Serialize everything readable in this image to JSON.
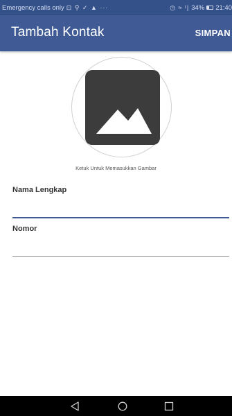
{
  "status_bar": {
    "carrier_text": "Emergency calls only",
    "notification_glyphs": "⊡ ⚲ ✓ ▲ ···",
    "status_glyphs": "◷ ≈ ᵗ|",
    "battery": "34%",
    "time": "21:40"
  },
  "app_bar": {
    "title": "Tambah Kontak",
    "save_label": "SIMPAN"
  },
  "image_picker": {
    "caption": "Ketuk Untuk Memasukkan Gambar",
    "icon": "image-placeholder-icon"
  },
  "form": {
    "name_label": "Nama Lengkap",
    "name_value": "",
    "number_label": "Nomor",
    "number_value": ""
  },
  "nav_bar": {
    "back_icon": "back-triangle-icon",
    "home_icon": "home-circle-icon",
    "recents_icon": "recents-square-icon"
  },
  "colors": {
    "status_bar": "#35518a",
    "app_bar": "#3f5a95",
    "accent": "#3f5a95",
    "icon_dark": "#3c3c3c",
    "nav_bar": "#000000"
  }
}
